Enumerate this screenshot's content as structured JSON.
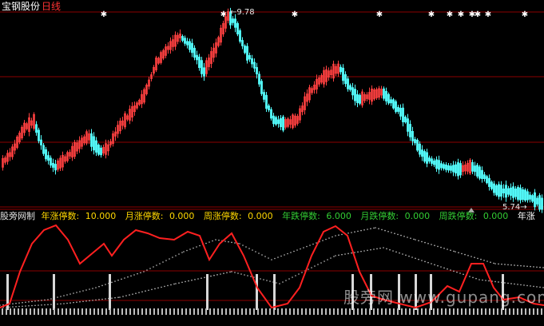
{
  "header": {
    "stock_name": "宝钢股份",
    "period": "日线"
  },
  "price_chart": {
    "high_label": "9.78",
    "low_label": "5.74",
    "colors": {
      "up": "#ff4040",
      "down": "#54ffff",
      "grid": "#8b0000"
    }
  },
  "indicator": {
    "name": "股旁网制",
    "items": [
      {
        "label": "年涨停数:",
        "value": "10.000",
        "color": "#ffd700"
      },
      {
        "label": "月涨停数:",
        "value": "0.000",
        "color": "#ffd700"
      },
      {
        "label": "周涨停数:",
        "value": "0.000",
        "color": "#ffd700"
      },
      {
        "label": "年跌停数:",
        "value": "6.000",
        "color": "#33cc33"
      },
      {
        "label": "月跌停数:",
        "value": "0.000",
        "color": "#33cc33"
      },
      {
        "label": "周跌停数:",
        "value": "0.000",
        "color": "#33cc33"
      }
    ],
    "trailing": "年涨",
    "line_color": "#ff2020",
    "dot_color": "#c8c8c8"
  },
  "watermark": "股旁网 www.gupang.com",
  "chart_data": {
    "type": "candlestick",
    "title": "宝钢股份 日线",
    "high_label": "9.78",
    "low_label": "5.74",
    "indicator_series": [
      {
        "name": "年涨停数",
        "value": 10.0
      },
      {
        "name": "月涨停数",
        "value": 0.0
      },
      {
        "name": "周涨停数",
        "value": 0.0
      },
      {
        "name": "年跌停数",
        "value": 6.0
      },
      {
        "name": "月跌停数",
        "value": 0.0
      },
      {
        "name": "周跌停数",
        "value": 0.0
      }
    ]
  }
}
